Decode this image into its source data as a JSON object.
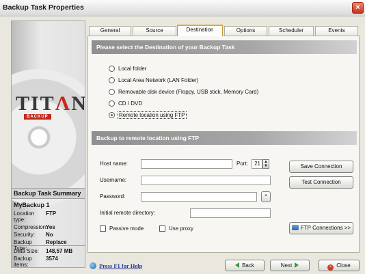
{
  "window": {
    "title": "Backup Task Properties",
    "close_icon": "close-icon"
  },
  "tabs": [
    {
      "label": "General"
    },
    {
      "label": "Source"
    },
    {
      "label": "Destination",
      "active": true
    },
    {
      "label": "Options"
    },
    {
      "label": "Scheduler"
    },
    {
      "label": "Events"
    }
  ],
  "destination": {
    "header": "Please select the Destination of your Backup Task",
    "options": [
      {
        "label": "Local folder",
        "checked": false
      },
      {
        "label": "Local Area Network (LAN Folder)",
        "checked": false
      },
      {
        "label": "Removable disk device (Floppy, USB stick, Memory Card)",
        "checked": false
      },
      {
        "label": "CD / DVD",
        "checked": false
      },
      {
        "label": "Remote location using FTP",
        "checked": true
      }
    ]
  },
  "ftp": {
    "header": "Backup to remote location using FTP",
    "host_label": "Host name:",
    "host_value": "",
    "port_label": "Port:",
    "port_value": "21",
    "username_label": "Username:",
    "username_value": "",
    "password_label": "Password:",
    "password_value": "",
    "password_btn": "*",
    "initial_dir_label": "Initial remote directory:",
    "initial_dir_value": "",
    "passive_label": "Passive mode",
    "proxy_label": "Use proxy",
    "save_connection": "Save Connection",
    "test_connection": "Test Connection",
    "ftp_connections": "FTP Connections >>"
  },
  "sidebar": {
    "logo_word_1": "TIT",
    "logo_word_2": "Λ",
    "logo_word_3": "N",
    "logo_sub": "BACKUP",
    "summary_title": "Backup Task Summary",
    "task_name": "MyBackup 1",
    "rows": [
      {
        "k": "Location type:",
        "v": "FTP"
      },
      {
        "k": "Compression:",
        "v": "Yes"
      },
      {
        "k": "Security:",
        "v": "No"
      },
      {
        "k": "Backup Type:",
        "v": "Replace"
      }
    ],
    "stats": [
      {
        "k": "Data Size:",
        "v": "148,57 MB"
      },
      {
        "k": "Backup items:",
        "v": "3574"
      }
    ]
  },
  "footer": {
    "help": "Press F1 for Help",
    "back": "Back",
    "next": "Next",
    "close": "Close"
  },
  "colors": {
    "accent_tab": "#e9a72f",
    "link": "#24399a",
    "close_red": "#d13b22"
  }
}
